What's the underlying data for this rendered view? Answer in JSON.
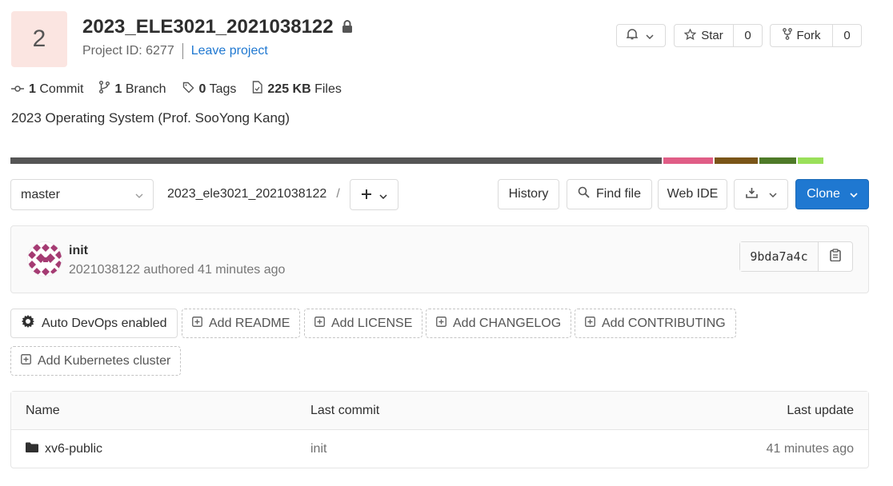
{
  "project": {
    "avatar_letter": "2",
    "name": "2023_ELE3021_2021038122",
    "id_label": "Project ID: 6277",
    "leave_label": "Leave project",
    "description": "2023 Operating System (Prof. SooYong Kang)"
  },
  "header_actions": {
    "star_label": "Star",
    "star_count": "0",
    "fork_label": "Fork",
    "fork_count": "0"
  },
  "stats": {
    "commits_count": "1",
    "commits_label": "Commit",
    "branches_count": "1",
    "branches_label": "Branch",
    "tags_count": "0",
    "tags_label": "Tags",
    "files_size": "225 KB",
    "files_label": "Files"
  },
  "language_bar": [
    {
      "color": "#555555",
      "fraction": 0.759
    },
    {
      "color": "#e05d86",
      "fraction": 0.058
    },
    {
      "color": "#7a5518",
      "fraction": 0.05
    },
    {
      "color": "#4e7a28",
      "fraction": 0.043
    },
    {
      "color": "#9ae05a",
      "fraction": 0.03
    }
  ],
  "toolbar": {
    "branch": "master",
    "path": "2023_ele3021_2021038122",
    "history_label": "History",
    "find_file_label": "Find file",
    "web_ide_label": "Web IDE",
    "clone_label": "Clone"
  },
  "last_commit": {
    "title": "init",
    "meta": "2021038122 authored 41 minutes ago",
    "sha": "9bda7a4c"
  },
  "actions": {
    "auto_devops": "Auto DevOps enabled",
    "add_readme": "Add README",
    "add_license": "Add LICENSE",
    "add_changelog": "Add CHANGELOG",
    "add_contributing": "Add CONTRIBUTING",
    "add_k8s": "Add Kubernetes cluster"
  },
  "file_table": {
    "headers": [
      "Name",
      "Last commit",
      "Last update"
    ],
    "rows": [
      {
        "name": "xv6-public",
        "last_commit": "init",
        "last_update": "41 minutes ago"
      }
    ]
  },
  "colors": {
    "primary": "#1f78d1",
    "avatar_bg": "#fbe5e1"
  }
}
